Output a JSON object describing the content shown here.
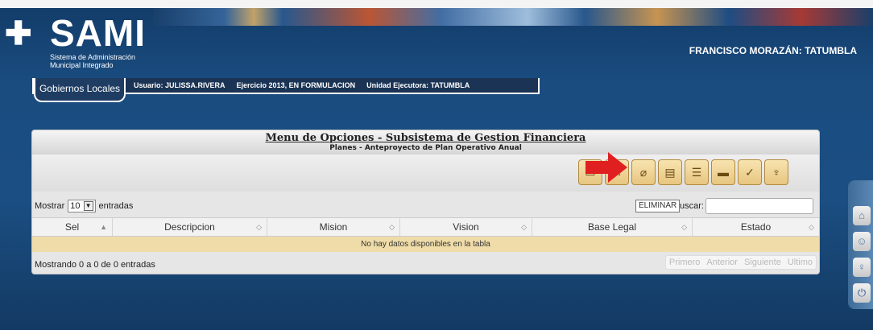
{
  "header": {
    "logo_mark": "✚",
    "app_name": "SAMI",
    "app_subtitle_line1": "Sistema de Administración",
    "app_subtitle_line2": "Municipal Integrado",
    "region": "FRANCISCO MORAZÁN: TATUMBLA"
  },
  "infobar": {
    "tab": "Gobiernos Locales",
    "usuario": "Usuario: JULISSA.RIVERA",
    "ejercicio": "Ejercicio 2013, EN FORMULACION",
    "unidad": "Unidad Ejecutora: TATUMBLA"
  },
  "panel": {
    "title": "Menu de Opciones - Subsistema de Gestion Financiera",
    "subtitle": "Planes - Anteproyecto de Plan Operativo Anual"
  },
  "toolbar": {
    "buttons": [
      {
        "icon": "folder-icon",
        "glyph": "▭"
      },
      {
        "icon": "edit-icon",
        "glyph": "✎"
      },
      {
        "icon": "delete-icon",
        "glyph": "⌀"
      },
      {
        "icon": "document-icon",
        "glyph": "▤"
      },
      {
        "icon": "list-icon",
        "glyph": "☰"
      },
      {
        "icon": "print-icon",
        "glyph": "▬"
      },
      {
        "icon": "check-icon",
        "glyph": "✓"
      },
      {
        "icon": "key-icon",
        "glyph": "♆"
      }
    ],
    "tooltip": "ELIMINAR",
    "arrow_color": "#e02020"
  },
  "table": {
    "length_label_before": "Mostrar",
    "length_value": "10",
    "length_label_after": "entradas",
    "search_label": "uscar:",
    "columns": [
      "Sel",
      "Descripcion",
      "Mision",
      "Vision",
      "Base Legal",
      "Estado"
    ],
    "empty_message": "No hay datos disponibles en la tabla",
    "info": "Mostrando 0 a 0 de 0 entradas",
    "pager": [
      "Primero",
      "Anterior",
      "Siguiente",
      "Ultimo"
    ]
  },
  "sidebar": {
    "buttons": [
      {
        "icon": "home-icon",
        "glyph": "⌂"
      },
      {
        "icon": "user-card-icon",
        "glyph": "☺"
      },
      {
        "icon": "key-icon",
        "glyph": "♀"
      },
      {
        "icon": "power-icon",
        "glyph": "⏻"
      }
    ]
  }
}
